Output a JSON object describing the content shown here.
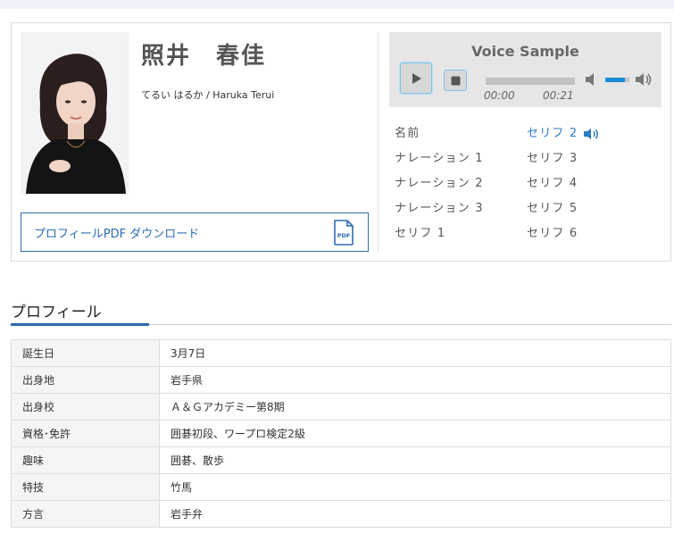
{
  "profile": {
    "name": "照井　春佳",
    "reading": "てるい はるか  /  Haruka Terui",
    "pdf_label": "プロフィールPDF  ダウンロード",
    "pdf_icon_text": "PDF"
  },
  "player": {
    "title": "Voice Sample",
    "current_time": "00:00",
    "duration": "00:21",
    "progress": 0,
    "volume": 0.8
  },
  "samples": {
    "col1": [
      "名前",
      "ナレーション 1",
      "ナレーション 2",
      "ナレーション 3",
      "セリフ 1"
    ],
    "col2": [
      "セリフ 2",
      "セリフ 3",
      "セリフ 4",
      "セリフ 5",
      "セリフ 6"
    ],
    "active": "セリフ 2",
    "active_color": "#2a7cc6"
  },
  "section": {
    "title": "プロフィール",
    "accent_color": "#2a6cb3"
  },
  "table": {
    "rows": [
      {
        "label": "誕生日",
        "value": "3月7日"
      },
      {
        "label": "出身地",
        "value": "岩手県"
      },
      {
        "label": "出身校",
        "value": "Ａ＆Ｇアカデミー第8期"
      },
      {
        "label": "資格･免許",
        "value": "囲碁初段、ワープロ検定2級"
      },
      {
        "label": "趣味",
        "value": "囲碁、散歩"
      },
      {
        "label": "特技",
        "value": "竹馬"
      },
      {
        "label": "方言",
        "value": "岩手弁"
      }
    ]
  }
}
